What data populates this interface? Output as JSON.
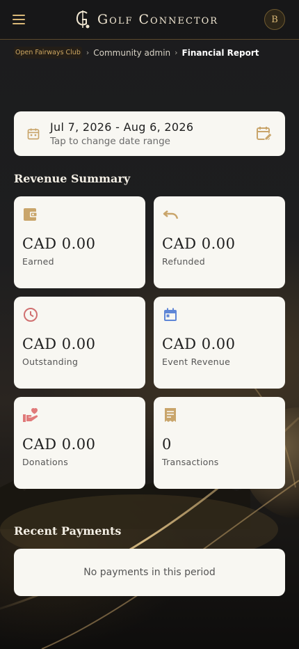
{
  "header": {
    "brand_name": "Golf Connector",
    "avatar_initial": "B"
  },
  "breadcrumb": {
    "club": "Open Fairways Club",
    "separator": "›",
    "admin": "Community admin",
    "current": "Financial Report"
  },
  "date_range": {
    "value": "Jul 7, 2026 - Aug 6, 2026",
    "hint": "Tap to change date range"
  },
  "revenue_summary": {
    "title": "Revenue Summary",
    "cards": [
      {
        "icon": "wallet-icon",
        "value": "CAD 0.00",
        "label": "Earned",
        "color": "#c9a56b"
      },
      {
        "icon": "undo-icon",
        "value": "CAD 0.00",
        "label": "Refunded",
        "color": "#c9a56b"
      },
      {
        "icon": "clock-icon",
        "value": "CAD 0.00",
        "label": "Outstanding",
        "color": "#d07070"
      },
      {
        "icon": "calendar-icon",
        "value": "CAD 0.00",
        "label": "Event Revenue",
        "color": "#5f86d6"
      },
      {
        "icon": "donation-icon",
        "value": "CAD 0.00",
        "label": "Donations",
        "color": "#e07a7a"
      },
      {
        "icon": "receipt-icon",
        "value": "0",
        "label": "Transactions",
        "color": "#c9a56b"
      }
    ]
  },
  "recent_payments": {
    "title": "Recent Payments",
    "empty_text": "No payments in this period"
  }
}
